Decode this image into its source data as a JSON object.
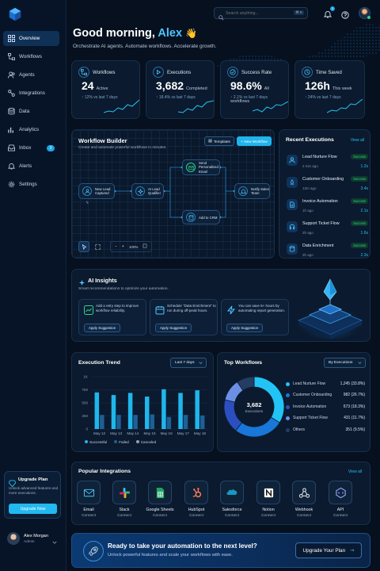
{
  "colors": {
    "accent": "#22c4f5",
    "success": "#2ed38b",
    "bg": "#06101f",
    "card": "#0b1a2e",
    "upgrade_btn": "#22b8f0"
  },
  "topbar": {
    "search_placeholder": "Search anything...",
    "shortcut": "⌘ K",
    "notification_count": "3"
  },
  "sidebar": {
    "logo_icon": "cube-logo-icon",
    "items": [
      {
        "label": "Overview",
        "icon": "grid-icon",
        "active": true
      },
      {
        "label": "Workflows",
        "icon": "workflow-icon"
      },
      {
        "label": "Agents",
        "icon": "users-icon"
      },
      {
        "label": "Integrations",
        "icon": "integrations-icon"
      },
      {
        "label": "Data",
        "icon": "database-icon"
      },
      {
        "label": "Analytics",
        "icon": "chart-icon"
      },
      {
        "label": "Inbox",
        "icon": "inbox-icon",
        "badge": "3"
      },
      {
        "label": "Alerts",
        "icon": "bell-icon"
      },
      {
        "label": "Settings",
        "icon": "gear-icon"
      }
    ],
    "upgrade": {
      "title": "Upgrade Plan",
      "text": "Unlock advanced features and more executions.",
      "button": "Upgrade Now"
    },
    "user": {
      "name": "Alex Morgan",
      "role": "Admin"
    }
  },
  "greeting": {
    "prefix": "Good morning,",
    "name": "Alex",
    "wave": "👋",
    "subtitle": "Orchestrate AI agents. Automate workflows. Accelerate growth."
  },
  "stats": [
    {
      "title": "Workflows",
      "value": "24",
      "sub": "Active",
      "trend": "↑ 12% vs last 7 days",
      "icon": "workflow-icon"
    },
    {
      "title": "Executions",
      "value": "3,682",
      "sub": "Completed",
      "trend": "↑ 18.4% vs last 7 days",
      "icon": "play-icon"
    },
    {
      "title": "Success Rate",
      "value": "98.6%",
      "sub": "All workflows",
      "trend": "↑ 2.1% vs last 7 days",
      "icon": "check-circle-icon"
    },
    {
      "title": "Time Saved",
      "value": "126h",
      "sub": "This week",
      "trend": "↑ 24% vs last 7 days",
      "icon": "clock-icon"
    }
  ],
  "builder": {
    "title": "Workflow Builder",
    "subtitle": "Create and automate powerful workflows in minutes.",
    "templates": "Templates",
    "new_workflow": "+ New Workflow",
    "nodes": {
      "trigger": "New Lead Captured",
      "qualifier": "AI Lead Qualifier",
      "email": "Send Personalized Email",
      "notify": "Notify Sales Team",
      "crm": "Add to CRM"
    },
    "zoom": "100%",
    "zoom_minus": "−",
    "zoom_plus": "+"
  },
  "recent": {
    "title": "Recent Executions",
    "view_all": "View all",
    "items": [
      {
        "name": "Lead Nurture Flow",
        "time": "2 min ago",
        "status": "Success",
        "duration": "1.2s",
        "icon": "users-icon"
      },
      {
        "name": "Customer Onboarding",
        "time": "12m ago",
        "status": "Success",
        "duration": "3.4s",
        "icon": "rocket-icon"
      },
      {
        "name": "Invoice Automation",
        "time": "1h ago",
        "status": "Success",
        "duration": "2.1s",
        "icon": "document-icon"
      },
      {
        "name": "Support Ticket Flow",
        "time": "2h ago",
        "status": "Success",
        "duration": "1.6s",
        "icon": "headset-icon"
      },
      {
        "name": "Data Enrichment",
        "time": "3h ago",
        "status": "Success",
        "duration": "2.3s",
        "icon": "database-icon"
      }
    ]
  },
  "insights": {
    "title": "AI Insights",
    "subtitle": "Smart recommendations to optimize your automation.",
    "items": [
      {
        "text": "Add a retry step to improve workflow reliability.",
        "button": "Apply Suggestion",
        "icon": "trend-icon"
      },
      {
        "text": "Schedule \"Data Enrichment\" to run during off-peak hours.",
        "button": "Apply Suggestion",
        "icon": "calendar-icon"
      },
      {
        "text": "You can save 5+ hours by automating report generation.",
        "button": "Apply Suggestion",
        "icon": "bolt-icon"
      }
    ]
  },
  "trend": {
    "title": "Execution Trend",
    "range": "Last 7 days"
  },
  "chart_data": [
    {
      "type": "bar",
      "title": "Execution Trend",
      "categories": [
        "May 12",
        "May 13",
        "May 14",
        "May 15",
        "May 16",
        "May 17",
        "May 18"
      ],
      "yticks": [
        "1K",
        "750",
        "500",
        "250",
        "0"
      ],
      "ylim": [
        0,
        1000
      ],
      "series": [
        {
          "name": "Successful",
          "color": "#1fb6ec",
          "values": [
            700,
            650,
            690,
            620,
            760,
            690,
            740
          ]
        },
        {
          "name": "Failed",
          "color": "#1e5f95",
          "values": [
            270,
            270,
            270,
            280,
            230,
            270,
            260
          ]
        },
        {
          "name": "Canceled",
          "color": "#8fa0b8",
          "values": [
            10,
            10,
            10,
            10,
            10,
            10,
            10
          ]
        }
      ]
    },
    {
      "type": "pie",
      "title": "Top Workflows",
      "filter": "By Executions",
      "center_value": "3,682",
      "center_label": "Executions",
      "slices": [
        {
          "name": "Lead Nurture Flow",
          "value": "1,245 (33.8%)",
          "pct": 33.8,
          "color": "#22c4f5"
        },
        {
          "name": "Customer Onboarding",
          "value": "982 (26.7%)",
          "pct": 26.7,
          "color": "#1877d8"
        },
        {
          "name": "Invoice Automation",
          "value": "673 (18.3%)",
          "pct": 18.3,
          "color": "#2b4fbf"
        },
        {
          "name": "Support Ticket Flow",
          "value": "431 (11.7%)",
          "pct": 11.7,
          "color": "#6c8fe6"
        },
        {
          "name": "Others",
          "value": "351 (9.5%)",
          "pct": 9.5,
          "color": "#253d63"
        }
      ]
    }
  ],
  "integrations": {
    "title": "Popular Integrations",
    "view_all": "View all",
    "items": [
      {
        "name": "Email",
        "action": "Connect",
        "icon": "mail-icon"
      },
      {
        "name": "Slack",
        "action": "Connect",
        "icon": "slack-icon"
      },
      {
        "name": "Google Sheets",
        "action": "Connect",
        "icon": "sheets-icon"
      },
      {
        "name": "HubSpot",
        "action": "Connect",
        "icon": "hubspot-icon"
      },
      {
        "name": "Salesforce",
        "action": "Connect",
        "icon": "salesforce-icon"
      },
      {
        "name": "Notion",
        "action": "Connect",
        "icon": "notion-icon"
      },
      {
        "name": "Webhook",
        "action": "Connect",
        "icon": "webhook-icon"
      },
      {
        "name": "API",
        "action": "Connect",
        "icon": "api-icon"
      }
    ]
  },
  "cta": {
    "title": "Ready to take your automation to the next level?",
    "subtitle": "Unlock powerful features and scale your workflows with ease.",
    "button": "Upgrade Your Plan",
    "arrow": "→"
  }
}
